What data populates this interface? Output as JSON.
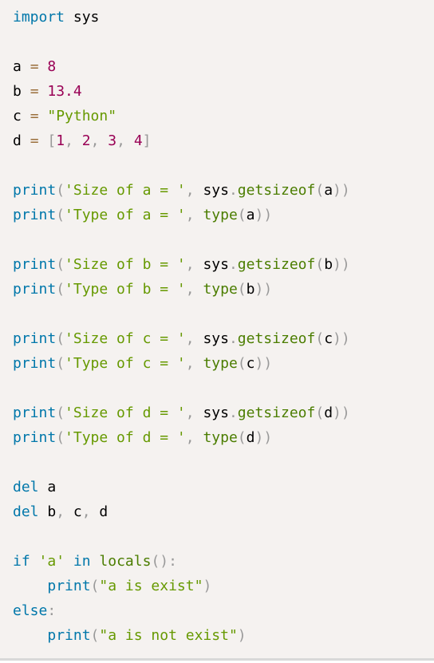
{
  "editor": {
    "language": "python",
    "lines": [
      [
        {
          "t": "import",
          "c": "kw"
        },
        {
          "t": " sys",
          "c": "id"
        }
      ],
      [],
      [
        {
          "t": "a ",
          "c": "id"
        },
        {
          "t": "=",
          "c": "op"
        },
        {
          "t": " ",
          "c": "id"
        },
        {
          "t": "8",
          "c": "num"
        }
      ],
      [
        {
          "t": "b ",
          "c": "id"
        },
        {
          "t": "=",
          "c": "op"
        },
        {
          "t": " ",
          "c": "id"
        },
        {
          "t": "13.4",
          "c": "num"
        }
      ],
      [
        {
          "t": "c ",
          "c": "id"
        },
        {
          "t": "=",
          "c": "op"
        },
        {
          "t": " ",
          "c": "id"
        },
        {
          "t": "\"Python\"",
          "c": "str"
        }
      ],
      [
        {
          "t": "d ",
          "c": "id"
        },
        {
          "t": "=",
          "c": "op"
        },
        {
          "t": " ",
          "c": "id"
        },
        {
          "t": "[",
          "c": "pun"
        },
        {
          "t": "1",
          "c": "num"
        },
        {
          "t": ", ",
          "c": "pun"
        },
        {
          "t": "2",
          "c": "num"
        },
        {
          "t": ", ",
          "c": "pun"
        },
        {
          "t": "3",
          "c": "num"
        },
        {
          "t": ", ",
          "c": "pun"
        },
        {
          "t": "4",
          "c": "num"
        },
        {
          "t": "]",
          "c": "pun"
        }
      ],
      [],
      [
        {
          "t": "print",
          "c": "kw"
        },
        {
          "t": "(",
          "c": "pun"
        },
        {
          "t": "'Size of a = '",
          "c": "str"
        },
        {
          "t": ", ",
          "c": "pun"
        },
        {
          "t": "sys",
          "c": "id"
        },
        {
          "t": ".",
          "c": "pun"
        },
        {
          "t": "getsizeof",
          "c": "fn"
        },
        {
          "t": "(",
          "c": "pun"
        },
        {
          "t": "a",
          "c": "id"
        },
        {
          "t": "))",
          "c": "pun"
        }
      ],
      [
        {
          "t": "print",
          "c": "kw"
        },
        {
          "t": "(",
          "c": "pun"
        },
        {
          "t": "'Type of a = '",
          "c": "str"
        },
        {
          "t": ", ",
          "c": "pun"
        },
        {
          "t": "type",
          "c": "fn"
        },
        {
          "t": "(",
          "c": "pun"
        },
        {
          "t": "a",
          "c": "id"
        },
        {
          "t": "))",
          "c": "pun"
        }
      ],
      [],
      [
        {
          "t": "print",
          "c": "kw"
        },
        {
          "t": "(",
          "c": "pun"
        },
        {
          "t": "'Size of b = '",
          "c": "str"
        },
        {
          "t": ", ",
          "c": "pun"
        },
        {
          "t": "sys",
          "c": "id"
        },
        {
          "t": ".",
          "c": "pun"
        },
        {
          "t": "getsizeof",
          "c": "fn"
        },
        {
          "t": "(",
          "c": "pun"
        },
        {
          "t": "b",
          "c": "id"
        },
        {
          "t": "))",
          "c": "pun"
        }
      ],
      [
        {
          "t": "print",
          "c": "kw"
        },
        {
          "t": "(",
          "c": "pun"
        },
        {
          "t": "'Type of b = '",
          "c": "str"
        },
        {
          "t": ", ",
          "c": "pun"
        },
        {
          "t": "type",
          "c": "fn"
        },
        {
          "t": "(",
          "c": "pun"
        },
        {
          "t": "b",
          "c": "id"
        },
        {
          "t": "))",
          "c": "pun"
        }
      ],
      [],
      [
        {
          "t": "print",
          "c": "kw"
        },
        {
          "t": "(",
          "c": "pun"
        },
        {
          "t": "'Size of c = '",
          "c": "str"
        },
        {
          "t": ", ",
          "c": "pun"
        },
        {
          "t": "sys",
          "c": "id"
        },
        {
          "t": ".",
          "c": "pun"
        },
        {
          "t": "getsizeof",
          "c": "fn"
        },
        {
          "t": "(",
          "c": "pun"
        },
        {
          "t": "c",
          "c": "id"
        },
        {
          "t": "))",
          "c": "pun"
        }
      ],
      [
        {
          "t": "print",
          "c": "kw"
        },
        {
          "t": "(",
          "c": "pun"
        },
        {
          "t": "'Type of c = '",
          "c": "str"
        },
        {
          "t": ", ",
          "c": "pun"
        },
        {
          "t": "type",
          "c": "fn"
        },
        {
          "t": "(",
          "c": "pun"
        },
        {
          "t": "c",
          "c": "id"
        },
        {
          "t": "))",
          "c": "pun"
        }
      ],
      [],
      [
        {
          "t": "print",
          "c": "kw"
        },
        {
          "t": "(",
          "c": "pun"
        },
        {
          "t": "'Size of d = '",
          "c": "str"
        },
        {
          "t": ", ",
          "c": "pun"
        },
        {
          "t": "sys",
          "c": "id"
        },
        {
          "t": ".",
          "c": "pun"
        },
        {
          "t": "getsizeof",
          "c": "fn"
        },
        {
          "t": "(",
          "c": "pun"
        },
        {
          "t": "d",
          "c": "id"
        },
        {
          "t": "))",
          "c": "pun"
        }
      ],
      [
        {
          "t": "print",
          "c": "kw"
        },
        {
          "t": "(",
          "c": "pun"
        },
        {
          "t": "'Type of d = '",
          "c": "str"
        },
        {
          "t": ", ",
          "c": "pun"
        },
        {
          "t": "type",
          "c": "fn"
        },
        {
          "t": "(",
          "c": "pun"
        },
        {
          "t": "d",
          "c": "id"
        },
        {
          "t": "))",
          "c": "pun"
        }
      ],
      [],
      [
        {
          "t": "del",
          "c": "kw"
        },
        {
          "t": " a",
          "c": "id"
        }
      ],
      [
        {
          "t": "del",
          "c": "kw"
        },
        {
          "t": " b",
          "c": "id"
        },
        {
          "t": ",",
          "c": "pun"
        },
        {
          "t": " c",
          "c": "id"
        },
        {
          "t": ",",
          "c": "pun"
        },
        {
          "t": " d",
          "c": "id"
        }
      ],
      [],
      [
        {
          "t": "if",
          "c": "kw"
        },
        {
          "t": " ",
          "c": "id"
        },
        {
          "t": "'a'",
          "c": "str"
        },
        {
          "t": " ",
          "c": "id"
        },
        {
          "t": "in",
          "c": "kw"
        },
        {
          "t": " ",
          "c": "id"
        },
        {
          "t": "locals",
          "c": "fn"
        },
        {
          "t": "():",
          "c": "pun"
        }
      ],
      [
        {
          "t": "    ",
          "c": "id"
        },
        {
          "t": "print",
          "c": "kw"
        },
        {
          "t": "(",
          "c": "pun"
        },
        {
          "t": "\"a is exist\"",
          "c": "str"
        },
        {
          "t": ")",
          "c": "pun"
        }
      ],
      [
        {
          "t": "else",
          "c": "kw"
        },
        {
          "t": ":",
          "c": "pun"
        }
      ],
      [
        {
          "t": "    ",
          "c": "id"
        },
        {
          "t": "print",
          "c": "kw"
        },
        {
          "t": "(",
          "c": "pun"
        },
        {
          "t": "\"a is not exist\"",
          "c": "str"
        },
        {
          "t": ")",
          "c": "pun"
        }
      ]
    ]
  }
}
